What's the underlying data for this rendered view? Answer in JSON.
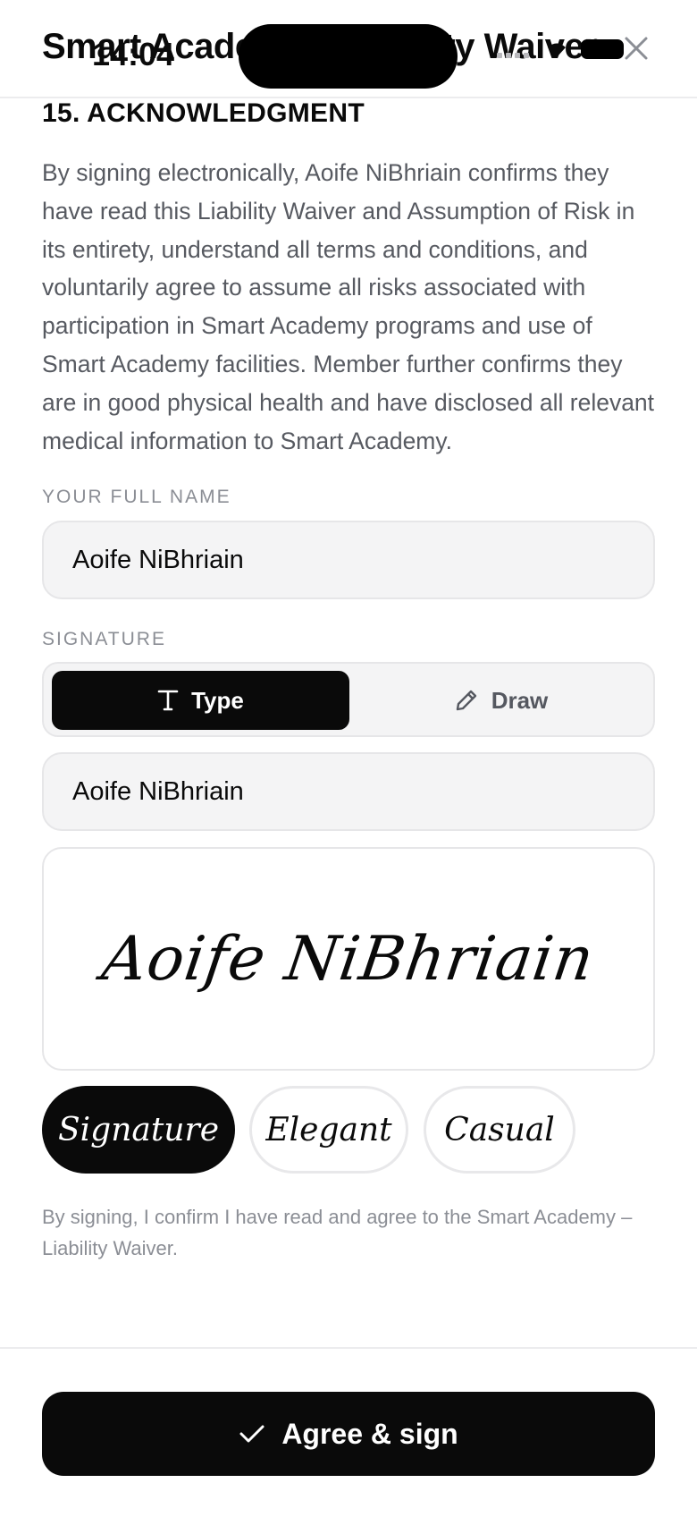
{
  "status_bar": {
    "time": "14:04"
  },
  "header": {
    "title": "Smart Academy – Liability Waiver"
  },
  "section": {
    "title": "15. ACKNOWLEDGMENT",
    "body": "By signing electronically, Aoife NiBhriain confirms they have read this Liability Waiver and Assumption of Risk in its entirety, understand all terms and conditions, and voluntarily agree to assume all risks associated with participation in Smart Academy programs and use of Smart Academy facilities. Member further confirms they are in good physical health and have disclosed all relevant medical information to Smart Academy."
  },
  "full_name": {
    "label": "YOUR FULL NAME",
    "value": "Aoife NiBhriain"
  },
  "signature": {
    "label": "SIGNATURE",
    "modes": {
      "type_label": "Type",
      "draw_label": "Draw",
      "selected": "Type"
    },
    "typed_value": "Aoife NiBhriain",
    "preview_text": "Aoife NiBhriain",
    "styles": [
      "Signature",
      "Elegant",
      "Casual"
    ],
    "selected_style": "Signature"
  },
  "consent_text": "By signing, I confirm I have read and agree to the Smart Academy – Liability Waiver.",
  "footer": {
    "button_label": "Agree & sign"
  },
  "colors": {
    "primary": "#0a0a0a",
    "field_bg": "#f4f4f5",
    "muted_text": "#8b8e95"
  }
}
